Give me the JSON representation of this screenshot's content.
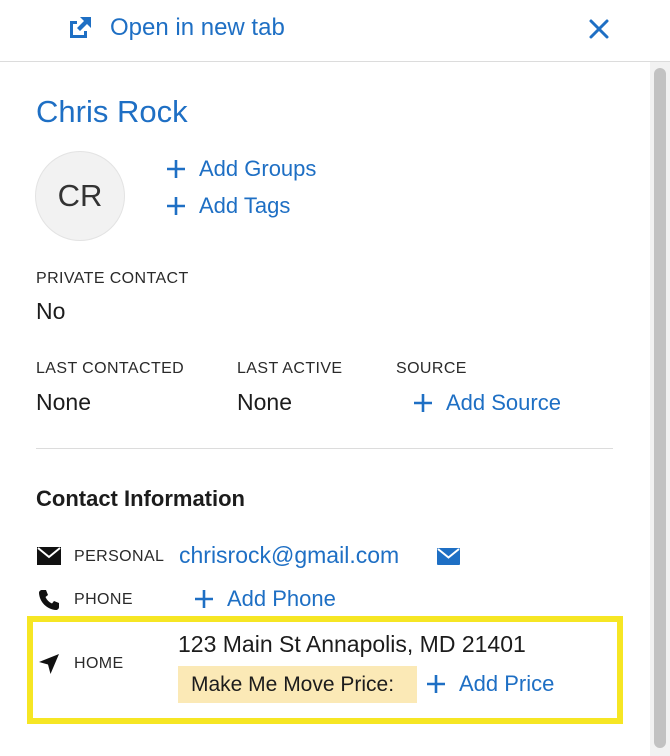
{
  "header": {
    "open_in_new_tab": "Open in new tab",
    "open_icon": "external-link-icon",
    "close_icon": "close-icon"
  },
  "contact": {
    "name": "Chris Rock",
    "initials": "CR",
    "add_groups": "Add Groups",
    "add_tags": "Add Tags",
    "private_contact_label": "PRIVATE CONTACT",
    "private_contact_value": "No",
    "last_contacted_label": "LAST CONTACTED",
    "last_contacted_value": "None",
    "last_active_label": "LAST ACTIVE",
    "last_active_value": "None",
    "source_label": "SOURCE",
    "add_source": "Add Source"
  },
  "contact_info": {
    "title": "Contact Information",
    "email": {
      "label": "PERSONAL",
      "value": "chrisrock@gmail.com",
      "icon": "envelope-icon"
    },
    "phone": {
      "label": "PHONE",
      "add_label": "Add Phone",
      "icon": "phone-icon"
    },
    "home": {
      "label": "HOME",
      "address": "123 Main St Annapolis, MD 21401",
      "price_label": "Make Me Move Price:",
      "add_price": "Add Price",
      "icon": "location-arrow-icon"
    }
  },
  "colors": {
    "link": "#1e6fc4",
    "highlight_border": "#f6e624",
    "price_background": "#fbe9b6"
  }
}
